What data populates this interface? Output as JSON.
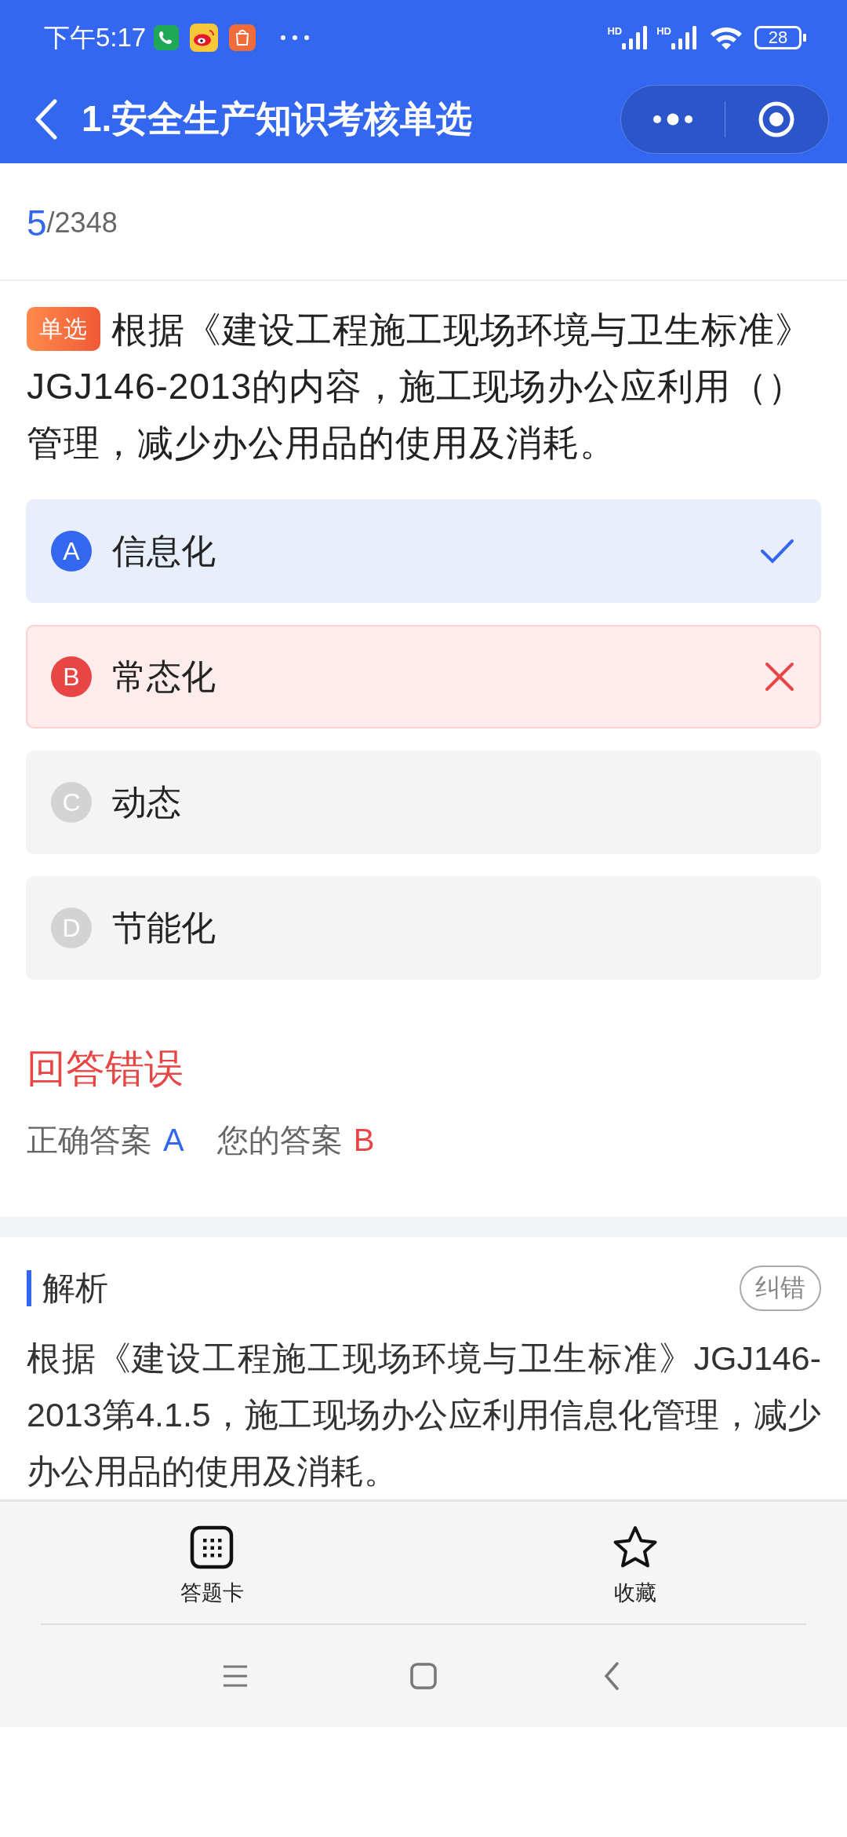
{
  "status_bar": {
    "time": "下午5:17",
    "signal_labels": [
      "HD",
      "HD"
    ],
    "battery": "28"
  },
  "header": {
    "title": "1.安全生产知识考核单选"
  },
  "progress": {
    "current": "5",
    "total": "/2348"
  },
  "question": {
    "tag": "单选",
    "text": "根据《建设工程施工现场环境与卫生标准》JGJ146-2013的内容，施工现场办公应利用（）管理，减少办公用品的使用及消耗。"
  },
  "options": [
    {
      "letter": "A",
      "text": "信息化",
      "correct": true,
      "selected": false
    },
    {
      "letter": "B",
      "text": "常态化",
      "correct": false,
      "selected": true
    },
    {
      "letter": "C",
      "text": "动态",
      "correct": false,
      "selected": false
    },
    {
      "letter": "D",
      "text": "节能化",
      "correct": false,
      "selected": false
    }
  ],
  "result": {
    "title": "回答错误",
    "correct_label": "正确答案",
    "correct_value": "A",
    "your_label": "您的答案",
    "your_value": "B"
  },
  "analysis": {
    "title": "解析",
    "report_button": "纠错",
    "text": "根据《建设工程施工现场环境与卫生标准》JGJ146-2013第4.1.5，施工现场办公应利用信息化管理，减少办公用品的使用及消耗。"
  },
  "bottom_bar": [
    {
      "kind": "grid",
      "label": "答题卡"
    },
    {
      "kind": "star",
      "label": "收藏"
    }
  ]
}
